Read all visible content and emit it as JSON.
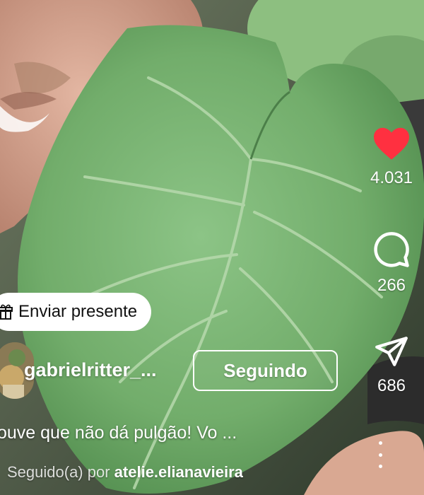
{
  "actions": {
    "like_count": "4.031",
    "comment_count": "266",
    "share_count": "686"
  },
  "gift": {
    "label": "Enviar presente"
  },
  "author": {
    "username": "gabrielritter_...",
    "follow_label": "Seguindo"
  },
  "caption": "ouve que não dá pulgão! Vo ...",
  "followed_by": {
    "prefix": "Seguido(a) por",
    "name": "atelie.elianavieira"
  },
  "icons": {
    "like": "heart-filled-icon",
    "comment": "comment-bubble-icon",
    "share": "paper-plane-icon",
    "gift": "gift-icon",
    "more": "more-vertical-icon"
  },
  "colors": {
    "like_red": "#ff3040",
    "leaf_green": "#6fa867"
  }
}
